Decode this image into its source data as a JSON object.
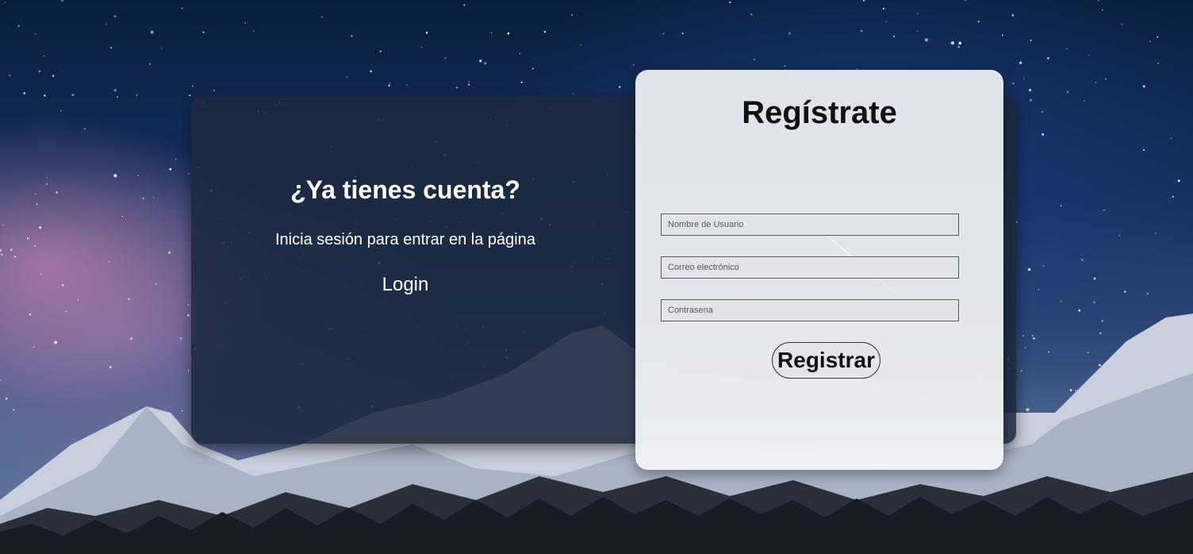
{
  "login_panel": {
    "title": "¿Ya tienes cuenta?",
    "subtitle": "Inicia sesión para entrar en la página",
    "login_label": "Login"
  },
  "register_panel": {
    "title": "Regístrate",
    "username_placeholder": "Nombre de Usuario",
    "email_placeholder": "Correo electrónico",
    "password_placeholder": "Contrasena",
    "submit_label": "Registrar"
  },
  "colors": {
    "dark_panel": "#1d293f",
    "card": "#eceef3",
    "sky_top": "#0b1d3c",
    "sky_pink": "#e796be"
  }
}
